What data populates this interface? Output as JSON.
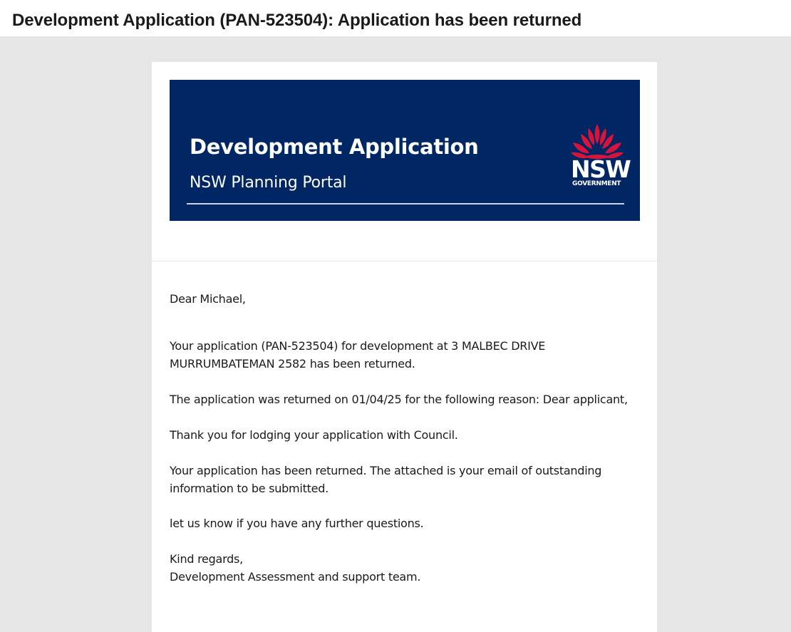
{
  "email": {
    "subject": "Development Application (PAN-523504): Application has been returned"
  },
  "banner": {
    "title": "Development Application",
    "subtitle": "NSW Planning Portal",
    "logo_text": "NSW",
    "logo_subtext": "GOVERNMENT",
    "logo_icon": "waratah-icon",
    "background_color": "#002664",
    "logo_color": "#d7153a"
  },
  "message": {
    "greeting": "Dear Michael,",
    "intro": "Your application (PAN-523504) for development at 3 MALBEC DRIVE MURRUMBATEMAN 2582 has been returned.",
    "returned_reason": "The application was returned on 01/04/25 for the following reason: Dear applicant,",
    "thanks": "Thank you for lodging your application with Council.",
    "outstanding": "Your application has been returned. The attached is your email of outstanding information to be submitted.",
    "questions": "let us know if you have any further questions.",
    "signoff": "Kind regards,",
    "team": "Development Assessment and support team."
  }
}
